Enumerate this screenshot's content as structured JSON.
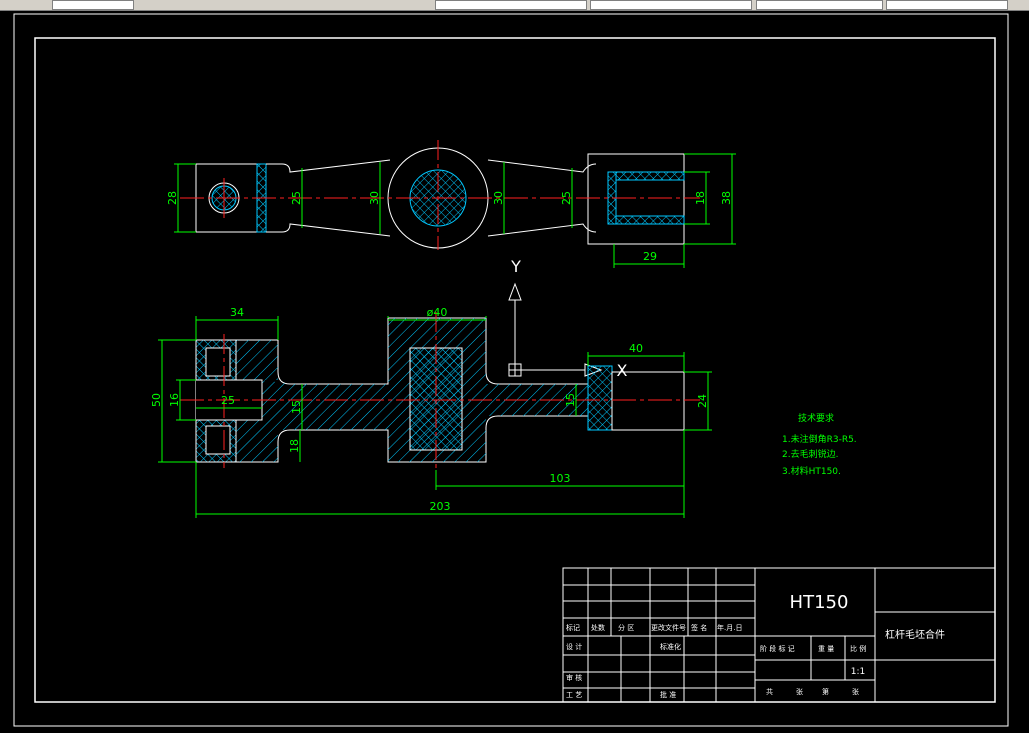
{
  "colors": {
    "background": "#000000",
    "outline": "#ffffff",
    "dimension": "#00ff00",
    "centerline": "#ff2020",
    "hatch": "#00c8ff",
    "title_block": "#ffffff",
    "notes": "#00ff00"
  },
  "toolbar": {
    "icon": "toolbar-strip"
  },
  "top_view": {
    "dims": {
      "left_height": "28",
      "neck_left": "25",
      "center_left": "30",
      "center_right": "30",
      "neck_right": "25",
      "inner_slot": "18",
      "right_height": "38",
      "slot_depth": "29"
    }
  },
  "front_view": {
    "dims": {
      "left_width": "34",
      "hub_diameter": "ø40",
      "right_length": "40",
      "overall_height": "50",
      "slot_height": "16",
      "slot_depth": "25",
      "web_left": "15",
      "web_right": "15",
      "lower_flange": "18",
      "right_height": "24",
      "half_length": "103",
      "overall_length": "203"
    }
  },
  "ucs": {
    "x_label": "X",
    "y_label": "Y"
  },
  "notes": {
    "title": "技术要求",
    "items": [
      "1.未注倒角R3-R5.",
      "2.去毛刺锐边.",
      "3.材料HT150."
    ]
  },
  "title_block": {
    "material": "HT150",
    "part_name": "杠杆毛坯合件",
    "scale": "1:1",
    "row_labels": {
      "mark": "标记",
      "count": "处数",
      "zone": "分 区",
      "change_doc": "更改文件号",
      "sign": "签 名",
      "date": "年.月.日",
      "designer": "设 计",
      "standardize": "标准化",
      "review": "审 核",
      "process": "工 艺",
      "approve": "批 准",
      "stage_mark": "阶 段 标 记",
      "weight": "重 量",
      "ratio": "比 例",
      "total": "共",
      "sheet_total": "张",
      "nth": "第",
      "sheet": "张"
    }
  }
}
